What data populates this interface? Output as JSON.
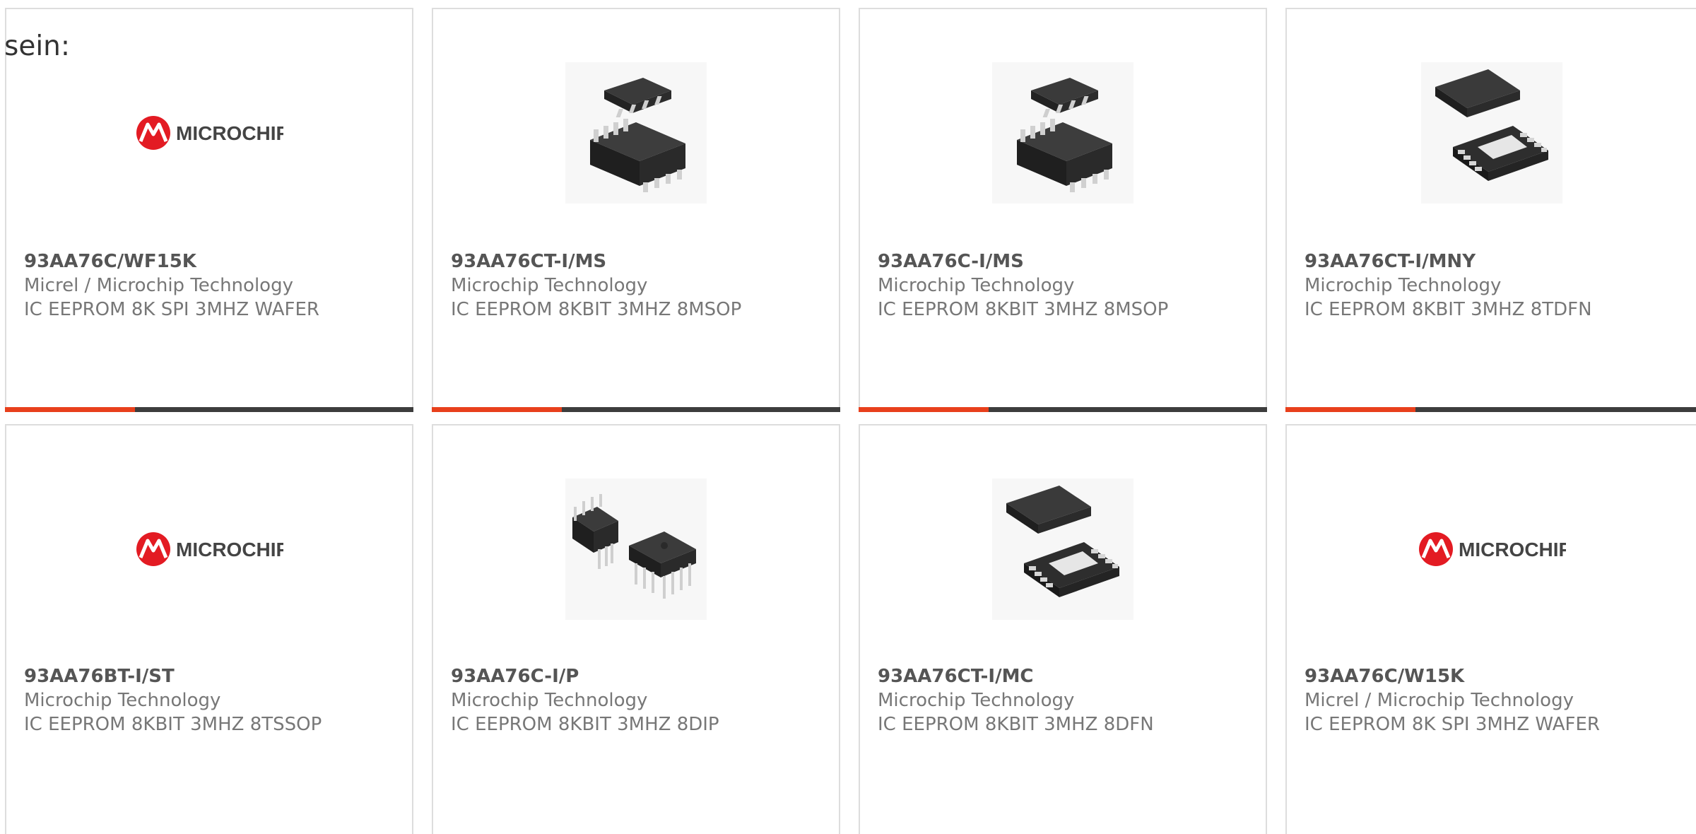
{
  "intro_text": "sein:",
  "brand": {
    "accent_color": "#e8401c",
    "bar_color": "#3d3d3d",
    "logo_color": "#e31b23"
  },
  "products": [
    {
      "part_number": "93AA76C/WF15K",
      "manufacturer": "Micrel / Microchip Technology",
      "description": "IC EEPROM 8K SPI 3MHZ WAFER",
      "image": "microchip-logo",
      "logo_text": "MICROCHIP"
    },
    {
      "part_number": "93AA76CT-I/MS",
      "manufacturer": "Microchip Technology",
      "description": "IC EEPROM 8KBIT 3MHZ 8MSOP",
      "image": "msop-package"
    },
    {
      "part_number": "93AA76C-I/MS",
      "manufacturer": "Microchip Technology",
      "description": "IC EEPROM 8KBIT 3MHZ 8MSOP",
      "image": "msop-package"
    },
    {
      "part_number": "93AA76CT-I/MNY",
      "manufacturer": "Microchip Technology",
      "description": "IC EEPROM 8KBIT 3MHZ 8TDFN",
      "image": "dfn-package"
    },
    {
      "part_number": "93AA76BT-I/ST",
      "manufacturer": "Microchip Technology",
      "description": "IC EEPROM 8KBIT 3MHZ 8TSSOP",
      "image": "microchip-logo",
      "logo_text": "MICROCHIP"
    },
    {
      "part_number": "93AA76C-I/P",
      "manufacturer": "Microchip Technology",
      "description": "IC EEPROM 8KBIT 3MHZ 8DIP",
      "image": "dip-package"
    },
    {
      "part_number": "93AA76CT-I/MC",
      "manufacturer": "Microchip Technology",
      "description": "IC EEPROM 8KBIT 3MHZ 8DFN",
      "image": "dfn-package"
    },
    {
      "part_number": "93AA76C/W15K",
      "manufacturer": "Micrel / Microchip Technology",
      "description": "IC EEPROM 8K SPI 3MHZ WAFER",
      "image": "microchip-logo",
      "logo_text": "MICROCHIP"
    }
  ]
}
